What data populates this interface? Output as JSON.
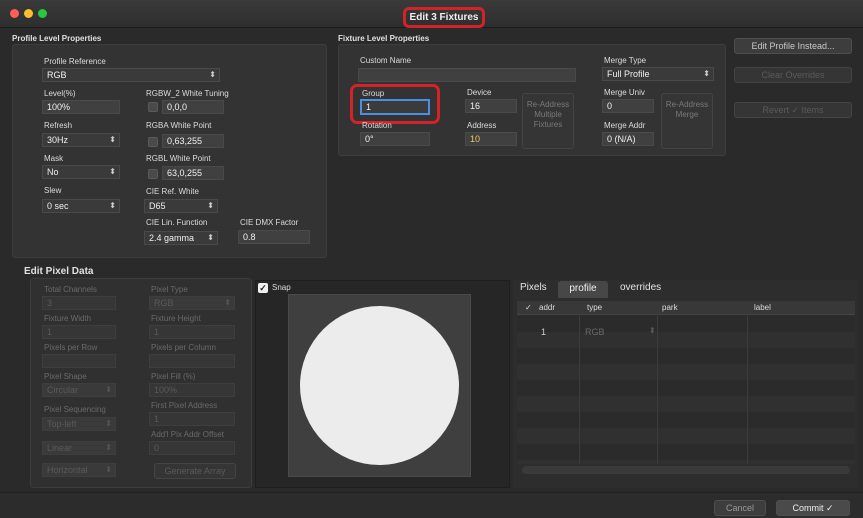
{
  "window": {
    "title": "Edit 3 Fixtures",
    "traffic_lights": [
      "#ff5f57",
      "#febc2e",
      "#28c840"
    ]
  },
  "profile_level": {
    "section_label": "Profile Level Properties",
    "profile_reference_label": "Profile Reference",
    "profile_reference_value": "RGB",
    "level_label": "Level(%)",
    "level_value": "100%",
    "refresh_label": "Refresh",
    "refresh_value": "30Hz",
    "mask_label": "Mask",
    "mask_value": "No",
    "slew_label": "Slew",
    "slew_value": "0 sec",
    "rgbw2_label": "RGBW_2 White Tuning",
    "rgbw2_value": "0,0,0",
    "rgba_label": "RGBA White Point",
    "rgba_value": "0,63,255",
    "rgbl_label": "RGBL White Point",
    "rgbl_value": "63,0,255",
    "cie_ref_label": "CIE Ref. White",
    "cie_ref_value": "D65",
    "cie_lin_label": "CIE Lin. Function",
    "cie_lin_value": "2.4 gamma",
    "cie_dmx_label": "CIE DMX Factor",
    "cie_dmx_value": "0.8"
  },
  "fixture_level": {
    "section_label": "Fixture Level Properties",
    "custom_name_label": "Custom Name",
    "custom_name_value": "",
    "group_label": "Group",
    "group_value": "1",
    "rotation_label": "Rotation",
    "rotation_value": "0°",
    "device_label": "Device",
    "device_value": "16",
    "address_label": "Address",
    "address_value": "10",
    "readdress_multiple_label": "Re-Address Multiple Fixtures",
    "merge_type_label": "Merge Type",
    "merge_type_value": "Full Profile",
    "merge_univ_label": "Merge Univ",
    "merge_univ_value": "0",
    "merge_addr_label": "Merge Addr",
    "merge_addr_value": "0 (N/A)",
    "readdress_merge_label": "Re-Address Merge"
  },
  "side_buttons": {
    "edit_profile": "Edit Profile Instead...",
    "clear_overrides": "Clear Overrides",
    "revert_items": "Revert ✓ Items"
  },
  "pixel_data": {
    "section_label": "Edit Pixel Data",
    "total_channels_label": "Total Channels",
    "total_channels_value": "3",
    "pixel_type_label": "Pixel Type",
    "pixel_type_value": "RGB",
    "fixture_width_label": "Fixture Width",
    "fixture_width_value": "1",
    "fixture_height_label": "Fixture Height",
    "fixture_height_value": "1",
    "pixels_per_row_label": "Pixels per Row",
    "pixels_per_row_value": "",
    "pixels_per_column_label": "Pixels per Column",
    "pixels_per_column_value": "",
    "pixel_shape_label": "Pixel Shape",
    "pixel_shape_value": "Circular",
    "pixel_fill_label": "Pixel Fill (%)",
    "pixel_fill_value": "100%",
    "pixel_sequencing_label": "Pixel Sequencing",
    "pixel_sequencing_value": "Top-left",
    "first_pixel_address_label": "First Pixel Address",
    "first_pixel_address_value": "1",
    "seq_mode_value": "Linear",
    "addtl_offset_label": "Add'l Pix Addr Offset",
    "addtl_offset_value": "0",
    "orientation_value": "Horizontal",
    "generate_array_label": "Generate Array",
    "snap_label": "Snap"
  },
  "pixels_table": {
    "tabs": [
      "Pixels",
      "profile",
      "overrides"
    ],
    "active_tab": "profile",
    "columns": [
      "✓",
      "addr",
      "type",
      "park",
      "label"
    ],
    "rows": [
      {
        "addr": "1",
        "type": "RGB",
        "park": "",
        "label": ""
      }
    ]
  },
  "footer": {
    "cancel": "Cancel",
    "commit": "Commit ✓"
  },
  "colors": {
    "highlight": "#d2232a",
    "address_yellow": "#e8c86a"
  }
}
